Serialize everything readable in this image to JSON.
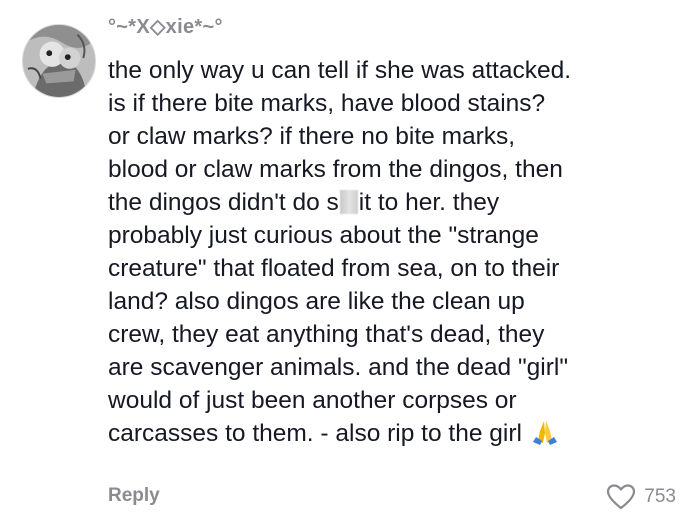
{
  "comment": {
    "username": "°~*X◇xie*~°",
    "lines": [
      "the only way u can tell if she was attacked.",
      "is if there bite marks, have blood stains?",
      "or claw marks? if there no bite marks,",
      "blood or claw marks from the dingos, then"
    ],
    "line5_before": "the dingos didn't do s",
    "line5_after": "it to her. they",
    "lines_rest": [
      "probably just curious about the \"strange",
      "creature\" that floated from sea, on to their",
      "land? also dingos are like the clean up",
      "crew, they eat anything that's dead, they",
      "are scavenger animals. and the dead \"girl\"",
      "would of just been another corpses or"
    ],
    "last_line": "carcasses to them. - also rip to the girl",
    "emoji": "folded-hands-emoji"
  },
  "actions": {
    "reply_label": "Reply",
    "like_count": "753"
  },
  "colors": {
    "text": "#161823",
    "muted": "#8a8b91"
  }
}
